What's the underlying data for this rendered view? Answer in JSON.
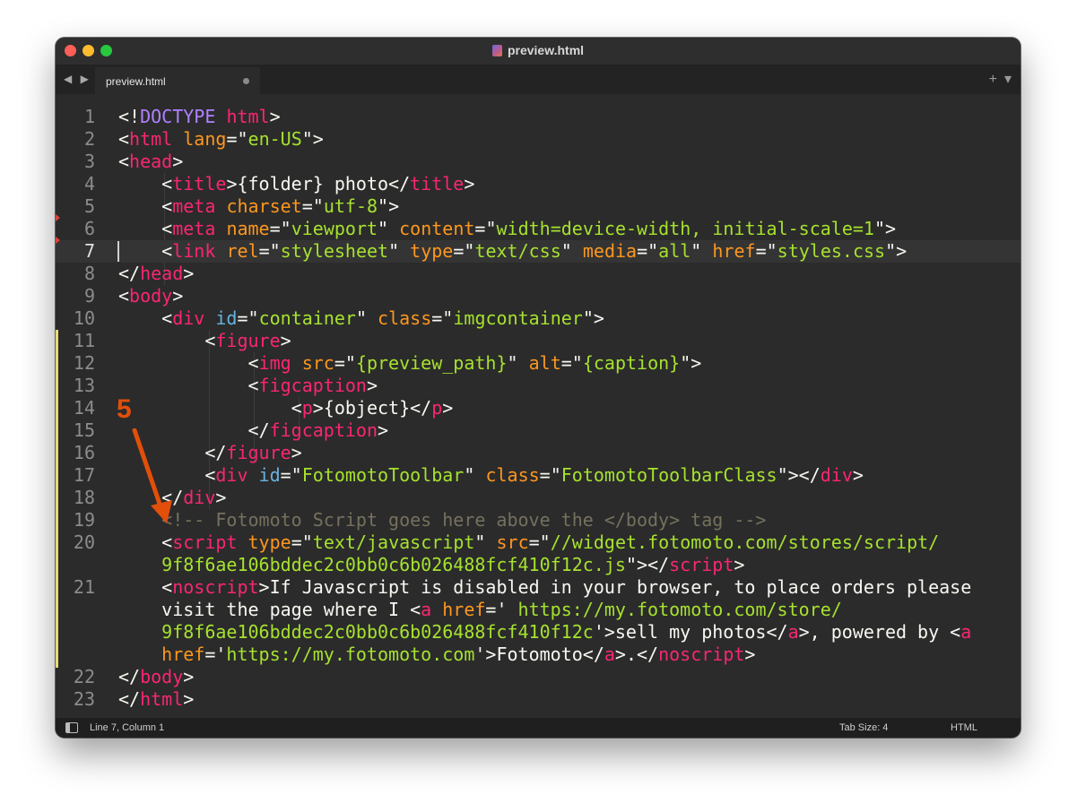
{
  "window": {
    "title": "preview.html"
  },
  "tab": {
    "label": "preview.html",
    "nav_arrows": "◀ ▶",
    "add_label": "+",
    "menu_label": "▾"
  },
  "editor": {
    "active_line": 7,
    "lines": [
      {
        "num": "1"
      },
      {
        "num": "2"
      },
      {
        "num": "3"
      },
      {
        "num": "4"
      },
      {
        "num": "5"
      },
      {
        "num": "6"
      },
      {
        "num": "7"
      },
      {
        "num": "8"
      },
      {
        "num": "9"
      },
      {
        "num": "10"
      },
      {
        "num": "11"
      },
      {
        "num": "12"
      },
      {
        "num": "13"
      },
      {
        "num": "14"
      },
      {
        "num": "15"
      },
      {
        "num": "16"
      },
      {
        "num": "17"
      },
      {
        "num": "18"
      },
      {
        "num": "19"
      },
      {
        "num": "20"
      },
      {
        "num": "21"
      },
      {
        "num": "22"
      },
      {
        "num": "23"
      }
    ],
    "code": [
      [
        [
          "pun",
          "<!"
        ],
        [
          "doc",
          "DOCTYPE"
        ],
        [
          "pun",
          " "
        ],
        [
          "tag",
          "html"
        ],
        [
          "pun",
          ">"
        ]
      ],
      [
        [
          "pun",
          "<"
        ],
        [
          "tag",
          "html"
        ],
        [
          "pun",
          " "
        ],
        [
          "attr",
          "lang"
        ],
        [
          "pun",
          "=\""
        ],
        [
          "str",
          "en-US"
        ],
        [
          "pun",
          "\">"
        ]
      ],
      [
        [
          "pun",
          "<"
        ],
        [
          "tag",
          "head"
        ],
        [
          "pun",
          ">"
        ]
      ],
      [
        [
          "pun",
          "    <"
        ],
        [
          "tag",
          "title"
        ],
        [
          "pun",
          ">{folder} photo</"
        ],
        [
          "tag",
          "title"
        ],
        [
          "pun",
          ">"
        ]
      ],
      [
        [
          "pun",
          "    <"
        ],
        [
          "tag",
          "meta"
        ],
        [
          "pun",
          " "
        ],
        [
          "attr",
          "charset"
        ],
        [
          "pun",
          "=\""
        ],
        [
          "str",
          "utf-8"
        ],
        [
          "pun",
          "\">"
        ]
      ],
      [
        [
          "pun",
          "    <"
        ],
        [
          "tag",
          "meta"
        ],
        [
          "pun",
          " "
        ],
        [
          "attr",
          "name"
        ],
        [
          "pun",
          "=\""
        ],
        [
          "str",
          "viewport"
        ],
        [
          "pun",
          "\" "
        ],
        [
          "attr",
          "content"
        ],
        [
          "pun",
          "=\""
        ],
        [
          "str",
          "width=device-width, initial-scale=1"
        ],
        [
          "pun",
          "\">"
        ]
      ],
      [
        [
          "pun",
          "    <"
        ],
        [
          "tag",
          "link"
        ],
        [
          "pun",
          " "
        ],
        [
          "attr",
          "rel"
        ],
        [
          "pun",
          "=\""
        ],
        [
          "str",
          "stylesheet"
        ],
        [
          "pun",
          "\" "
        ],
        [
          "attr",
          "type"
        ],
        [
          "pun",
          "=\""
        ],
        [
          "str",
          "text/css"
        ],
        [
          "pun",
          "\" "
        ],
        [
          "attr",
          "media"
        ],
        [
          "pun",
          "=\""
        ],
        [
          "str",
          "all"
        ],
        [
          "pun",
          "\" "
        ],
        [
          "attr",
          "href"
        ],
        [
          "pun",
          "=\""
        ],
        [
          "str",
          "styles.css"
        ],
        [
          "pun",
          "\">"
        ]
      ],
      [
        [
          "pun",
          "</"
        ],
        [
          "tag",
          "head"
        ],
        [
          "pun",
          ">"
        ]
      ],
      [
        [
          "pun",
          "<"
        ],
        [
          "tag",
          "body"
        ],
        [
          "pun",
          ">"
        ]
      ],
      [
        [
          "pun",
          "    <"
        ],
        [
          "tag",
          "div"
        ],
        [
          "pun",
          " "
        ],
        [
          "id",
          "id"
        ],
        [
          "pun",
          "=\""
        ],
        [
          "str",
          "container"
        ],
        [
          "pun",
          "\" "
        ],
        [
          "attr",
          "class"
        ],
        [
          "pun",
          "=\""
        ],
        [
          "str",
          "imgcontainer"
        ],
        [
          "pun",
          "\">"
        ]
      ],
      [
        [
          "pun",
          "        <"
        ],
        [
          "tag",
          "figure"
        ],
        [
          "pun",
          ">"
        ]
      ],
      [
        [
          "pun",
          "            <"
        ],
        [
          "tag",
          "img"
        ],
        [
          "pun",
          " "
        ],
        [
          "attr",
          "src"
        ],
        [
          "pun",
          "=\""
        ],
        [
          "str",
          "{preview_path}"
        ],
        [
          "pun",
          "\" "
        ],
        [
          "attr",
          "alt"
        ],
        [
          "pun",
          "=\""
        ],
        [
          "str",
          "{caption}"
        ],
        [
          "pun",
          "\">"
        ]
      ],
      [
        [
          "pun",
          "            <"
        ],
        [
          "tag",
          "figcaption"
        ],
        [
          "pun",
          ">"
        ]
      ],
      [
        [
          "pun",
          "                <"
        ],
        [
          "tag",
          "p"
        ],
        [
          "pun",
          ">{object}</"
        ],
        [
          "tag",
          "p"
        ],
        [
          "pun",
          ">"
        ]
      ],
      [
        [
          "pun",
          "            </"
        ],
        [
          "tag",
          "figcaption"
        ],
        [
          "pun",
          ">"
        ]
      ],
      [
        [
          "pun",
          "        </"
        ],
        [
          "tag",
          "figure"
        ],
        [
          "pun",
          ">"
        ]
      ],
      [
        [
          "pun",
          "        <"
        ],
        [
          "tag",
          "div"
        ],
        [
          "pun",
          " "
        ],
        [
          "id",
          "id"
        ],
        [
          "pun",
          "=\""
        ],
        [
          "str",
          "FotomotoToolbar"
        ],
        [
          "pun",
          "\" "
        ],
        [
          "attr",
          "class"
        ],
        [
          "pun",
          "=\""
        ],
        [
          "str",
          "FotomotoToolbarClass"
        ],
        [
          "pun",
          "\"></"
        ],
        [
          "tag",
          "div"
        ],
        [
          "pun",
          ">"
        ]
      ],
      [
        [
          "pun",
          "    </"
        ],
        [
          "tag",
          "div"
        ],
        [
          "pun",
          ">"
        ]
      ],
      [
        [
          "com",
          "    <!-- Fotomoto Script goes here above the </body> tag -->"
        ]
      ],
      [
        [
          "pun",
          "    <"
        ],
        [
          "tag",
          "script"
        ],
        [
          "pun",
          " "
        ],
        [
          "attr",
          "type"
        ],
        [
          "pun",
          "=\""
        ],
        [
          "str",
          "text/javascript"
        ],
        [
          "pun",
          "\" "
        ],
        [
          "attr",
          "src"
        ],
        [
          "pun",
          "=\""
        ],
        [
          "str",
          "//widget.fotomoto.com/stores/script/"
        ]
      ],
      [
        [
          "str",
          "    9f8f6ae106bddec2c0bb0c6b026488fcf410f12c.js"
        ],
        [
          "pun",
          "\"></"
        ],
        [
          "tag",
          "script"
        ],
        [
          "pun",
          ">"
        ]
      ],
      [
        [
          "pun",
          "    <"
        ],
        [
          "tag",
          "noscript"
        ],
        [
          "pun",
          ">If Javascript is disabled in your browser, to place orders please"
        ]
      ],
      [
        [
          "pun",
          "    visit the page where I <"
        ],
        [
          "tag",
          "a"
        ],
        [
          "pun",
          " "
        ],
        [
          "attr",
          "href"
        ],
        [
          "pun",
          "='"
        ],
        [
          "str",
          " https://my.fotomoto.com/store/"
        ]
      ],
      [
        [
          "str",
          "    9f8f6ae106bddec2c0bb0c6b026488fcf410f12c"
        ],
        [
          "pun",
          "'>sell my photos</"
        ],
        [
          "tag",
          "a"
        ],
        [
          "pun",
          ">, powered by <"
        ],
        [
          "tag",
          "a"
        ]
      ],
      [
        [
          "attr",
          "    href"
        ],
        [
          "pun",
          "='"
        ],
        [
          "str",
          "https://my.fotomoto.com"
        ],
        [
          "pun",
          "'>Fotomoto</"
        ],
        [
          "tag",
          "a"
        ],
        [
          "pun",
          ">.</"
        ],
        [
          "tag",
          "noscript"
        ],
        [
          "pun",
          ">"
        ]
      ],
      [
        [
          "pun",
          "</"
        ],
        [
          "tag",
          "body"
        ],
        [
          "pun",
          ">"
        ]
      ],
      [
        [
          "pun",
          "</"
        ],
        [
          "tag",
          "html"
        ],
        [
          "pun",
          ">"
        ]
      ]
    ],
    "code_line_map": [
      1,
      2,
      3,
      4,
      5,
      6,
      7,
      8,
      9,
      10,
      11,
      12,
      13,
      14,
      15,
      16,
      17,
      18,
      19,
      20,
      null,
      21,
      null,
      null,
      null,
      22,
      23
    ]
  },
  "annotation": {
    "label": "5",
    "color": "#e24f0a"
  },
  "status": {
    "position": "Line 7, Column 1",
    "tab_size": "Tab Size: 4",
    "syntax": "HTML"
  }
}
